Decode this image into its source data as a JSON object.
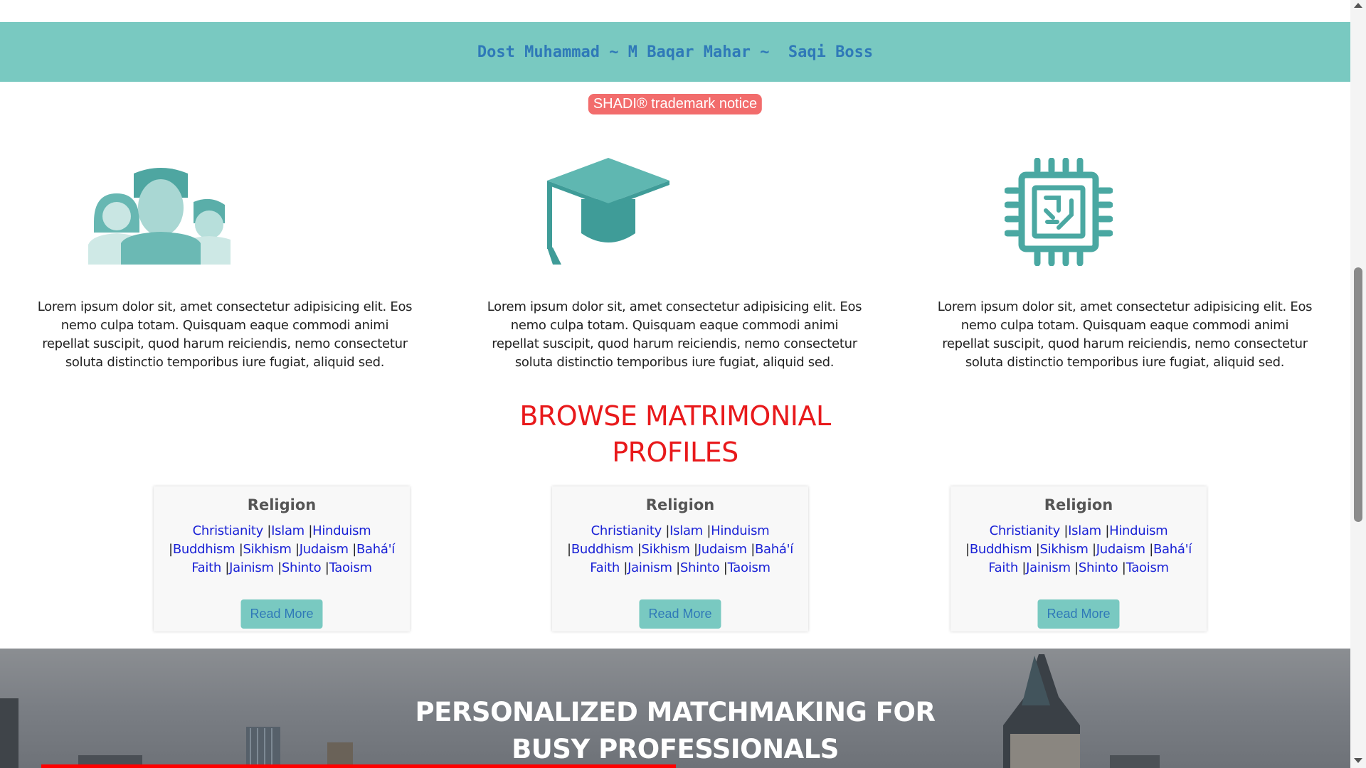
{
  "header": {
    "banner_text": "Dost Muhammad ~ M Baqar Mahar ~  Saqi Boss"
  },
  "trademark_badge": "SHADI® trademark notice",
  "features": [
    {
      "icon": "family-icon",
      "text": "Lorem ipsum dolor sit, amet consectetur adipisicing elit. Eos nemo culpa totam. Quisquam eaque commodi animi repellat suscipit, quod harum reiciendis, nemo consectetur soluta distinctio temporibus iure fugiat, aliquid sed."
    },
    {
      "icon": "graduation-cap-icon",
      "text": "Lorem ipsum dolor sit, amet consectetur adipisicing elit. Eos nemo culpa totam. Quisquam eaque commodi animi repellat suscipit, quod harum reiciendis, nemo consectetur soluta distinctio temporibus iure fugiat, aliquid sed."
    },
    {
      "icon": "microchip-icon",
      "text": "Lorem ipsum dolor sit, amet consectetur adipisicing elit. Eos nemo culpa totam. Quisquam eaque commodi animi repellat suscipit, quod harum reiciendis, nemo consectetur soluta distinctio temporibus iure fugiat, aliquid sed."
    }
  ],
  "browse": {
    "title_line1": "BROWSE MATRIMONIAL",
    "title_line2": "PROFILES"
  },
  "cards": [
    {
      "title": "Religion",
      "links": [
        "Christianity",
        "Islam",
        "Hinduism",
        "Buddhism",
        "Sikhism",
        "Judaism",
        "Bahá'í Faith",
        "Jainism",
        "Shinto",
        "Taoism"
      ],
      "button": "Read More"
    },
    {
      "title": "Religion",
      "links": [
        "Christianity",
        "Islam",
        "Hinduism",
        "Buddhism",
        "Sikhism",
        "Judaism",
        "Bahá'í Faith",
        "Jainism",
        "Shinto",
        "Taoism"
      ],
      "button": "Read More"
    },
    {
      "title": "Religion",
      "links": [
        "Christianity",
        "Islam",
        "Hinduism",
        "Buddhism",
        "Sikhism",
        "Judaism",
        "Bahá'í Faith",
        "Jainism",
        "Shinto",
        "Taoism"
      ],
      "button": "Read More"
    }
  ],
  "hero": {
    "title_line1": "PERSONALIZED MATCHMAKING FOR",
    "title_line2": "BUSY PROFESSIONALS"
  },
  "colors": {
    "banner_bg": "#79c9c1",
    "accent_blue": "#2f79b8",
    "badge_red": "#f26c6c",
    "title_red": "#e8191b",
    "link_blue": "#1a22d6"
  }
}
